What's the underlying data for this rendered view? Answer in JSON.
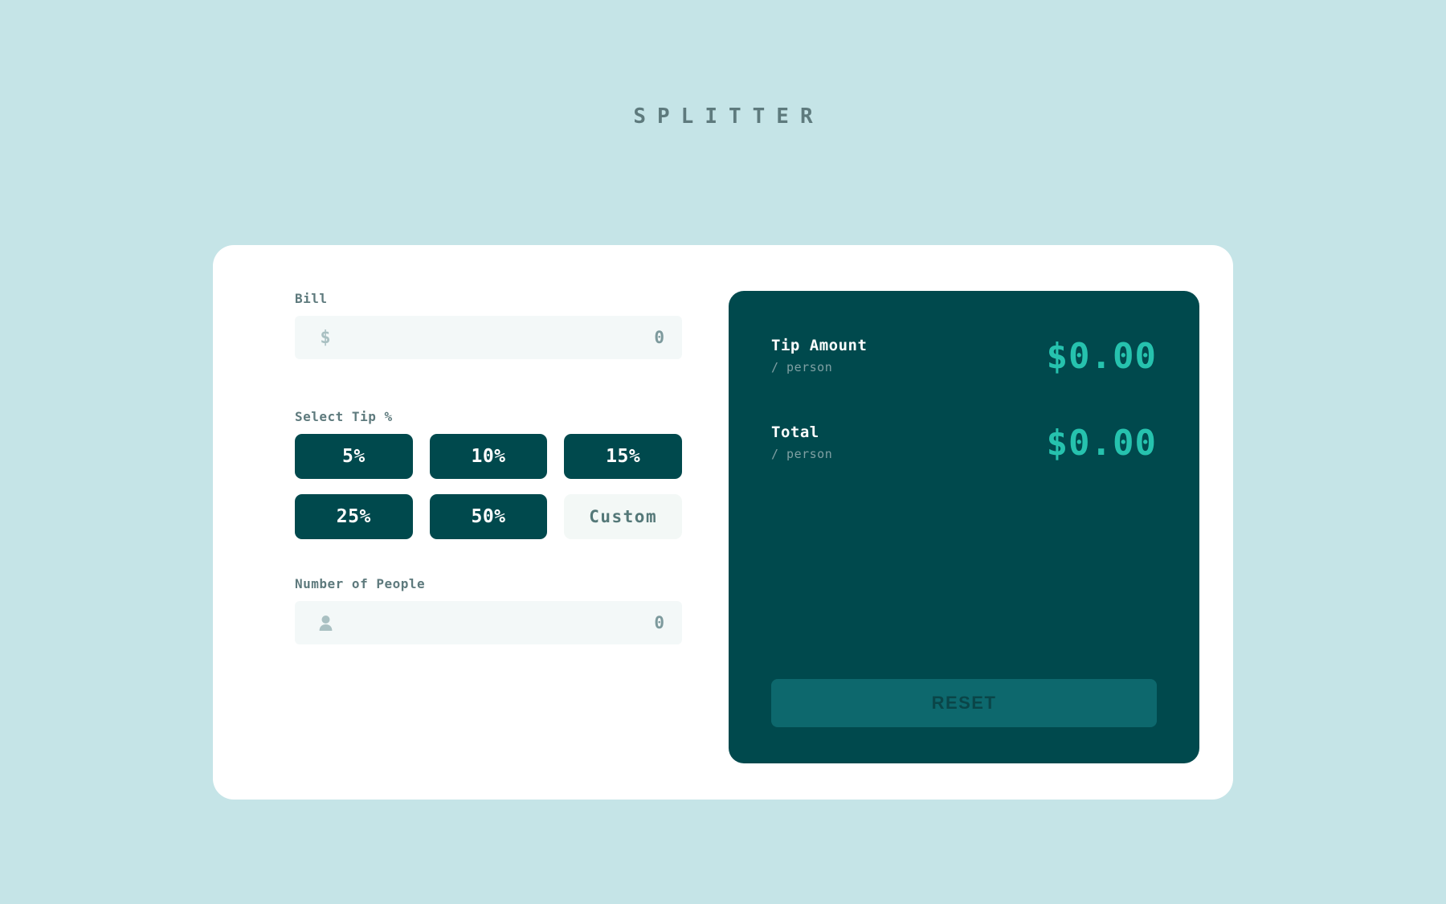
{
  "app": {
    "logo_line1": "SPLITTER",
    "background_color": "#C5E4E7",
    "card_color": "#FFFFFF",
    "panel_color": "#00494D",
    "accent_color": "#26C2AE"
  },
  "form": {
    "bill": {
      "label": "Bill",
      "icon": "dollar-icon",
      "value": "0",
      "placeholder": "0"
    },
    "tip": {
      "label": "Select Tip %",
      "options": [
        {
          "label": "5%",
          "selected": false,
          "custom": false
        },
        {
          "label": "10%",
          "selected": false,
          "custom": false
        },
        {
          "label": "15%",
          "selected": false,
          "custom": false
        },
        {
          "label": "25%",
          "selected": false,
          "custom": false
        },
        {
          "label": "50%",
          "selected": false,
          "custom": false
        },
        {
          "label": "Custom",
          "selected": false,
          "custom": true
        }
      ]
    },
    "people": {
      "label": "Number of People",
      "icon": "person-icon",
      "value": "0",
      "placeholder": "0"
    }
  },
  "results": {
    "rows": [
      {
        "title": "Tip Amount",
        "subtitle": "/ person",
        "amount": "$0.00"
      },
      {
        "title": "Total",
        "subtitle": "/ person",
        "amount": "$0.00"
      }
    ],
    "reset_label": "RESET"
  }
}
